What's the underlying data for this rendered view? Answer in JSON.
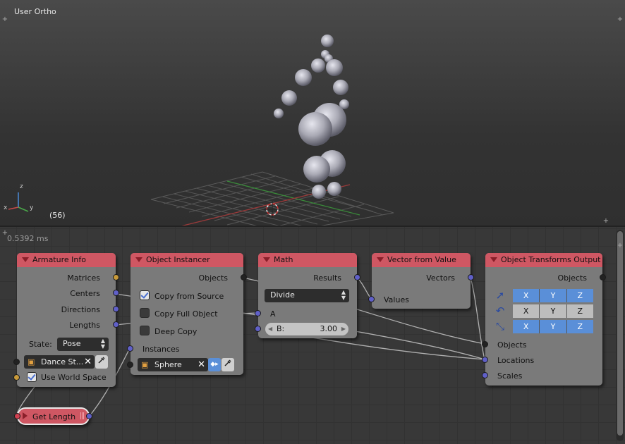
{
  "viewport": {
    "view_label": "User Ortho",
    "frame_label": "(56)",
    "axis_x": "x",
    "axis_y": "y",
    "axis_z": "z"
  },
  "editor": {
    "timing": "0.5392 ms"
  },
  "nodes": {
    "armature_info": {
      "title": "Armature Info",
      "outputs": [
        "Matrices",
        "Centers",
        "Directions",
        "Lengths"
      ],
      "state_label": "State:",
      "state_value": "Pose",
      "object_name": "Dance St...",
      "use_world_space_label": "Use World Space",
      "use_world_space": true
    },
    "get_length": {
      "title": "Get Length"
    },
    "object_instancer": {
      "title": "Object Instancer",
      "output": "Objects",
      "copy_from_source_label": "Copy from Source",
      "copy_from_source": true,
      "copy_full_object_label": "Copy Full Object",
      "copy_full_object": false,
      "deep_copy_label": "Deep Copy",
      "deep_copy": false,
      "instances_label": "Instances",
      "source_object": "Sphere"
    },
    "math": {
      "title": "Math",
      "output": "Results",
      "operation": "Divide",
      "input_a": "A",
      "input_b_label": "B:",
      "input_b_value": "3.00"
    },
    "vector_from_value": {
      "title": "Vector from Value",
      "output": "Vectors",
      "input": "Values"
    },
    "object_transforms_output": {
      "title": "Object Transforms Output",
      "output": "Objects",
      "axis_labels": [
        "X",
        "Y",
        "Z"
      ],
      "inputs": [
        "Objects",
        "Locations",
        "Scales"
      ]
    }
  },
  "colors": {
    "node_header": "#cf5763",
    "node_body": "#7a7a7a",
    "socket_vector": "#6060c8",
    "socket_matrix": "#c89a3a",
    "socket_object": "#222222",
    "axis_button_active": "#5a8fd8"
  }
}
